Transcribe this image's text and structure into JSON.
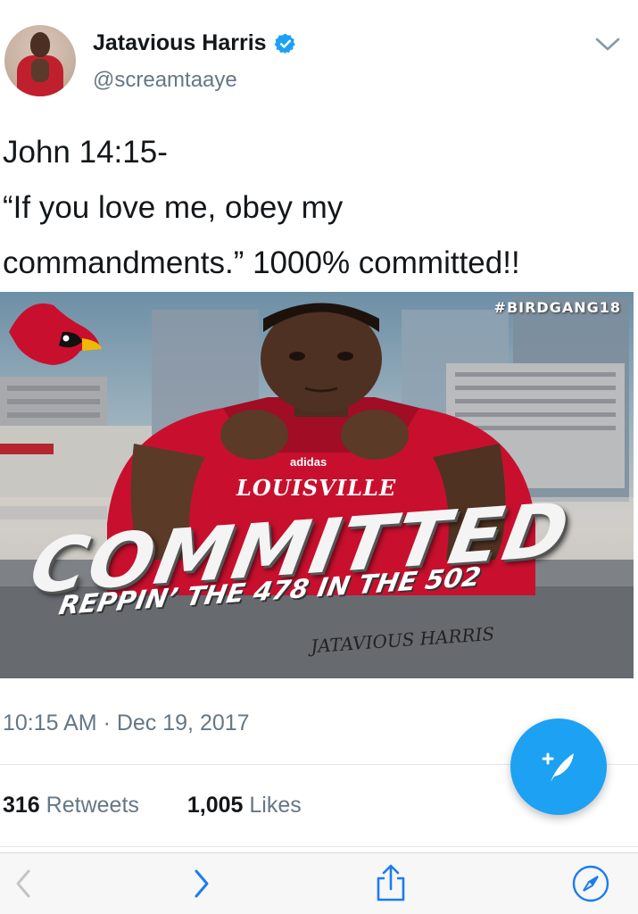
{
  "tweet": {
    "author": {
      "display_name": "Jatavious Harris",
      "handle": "@screamtaaye",
      "verified": true,
      "avatar_icon": "profile-photo"
    },
    "text_lines": [
      "John 14:15-",
      "“If you love me, obey my",
      "commandments.” 1000% committed!!"
    ],
    "media": {
      "hashtag": "#BIRDGANG18",
      "headline": "COMMITTED",
      "subheadline": "REPPIN’ THE 478 IN THE 502",
      "signature": "JATAVIOUS HARRIS",
      "jersey_brand": "adidas",
      "jersey_text": "LOUISVILLE",
      "logo_icon": "cardinal-logo"
    },
    "timestamp": "10:15 AM · Dec 19, 2017",
    "stats": {
      "retweets_count": "316",
      "retweets_label": "Retweets",
      "likes_count": "1,005",
      "likes_label": "Likes"
    }
  },
  "compose_button_icon": "compose-quill-icon",
  "browser_toolbar": {
    "back_icon": "chevron-left-icon",
    "forward_icon": "chevron-right-icon",
    "share_icon": "share-icon",
    "safari_icon": "compass-icon"
  },
  "colors": {
    "accent": "#1da1f2",
    "secondary_text": "#657786",
    "primary_text": "#14171a",
    "jersey_red": "#c8102e"
  }
}
